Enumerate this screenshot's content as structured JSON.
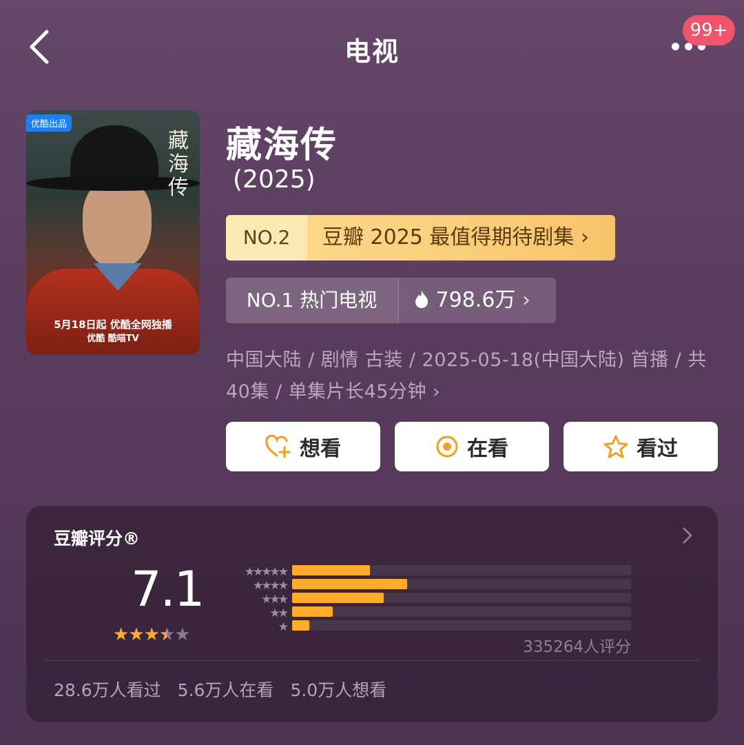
{
  "header": {
    "title": "电视",
    "badge": "99+"
  },
  "poster": {
    "tag": "优酷出品",
    "vertical_title": "藏海传",
    "line1": "5月18日起 优酷全网独播",
    "line2": "优酷 酷喵TV"
  },
  "show": {
    "title": "藏海传",
    "year": "(2025)"
  },
  "rankings": [
    {
      "no": "NO.2",
      "text": "豆瓣 2025 最值得期待剧集",
      "arrow": "›"
    },
    {
      "no": "NO.1 热门电视",
      "text": "798.6万",
      "arrow": "›"
    }
  ],
  "meta": {
    "line1": "中国大陆 / 剧情 古装 / 2025-05-18(中国大陆) 首播 / 共",
    "line2": "40集 / 单集片长45分钟 ›"
  },
  "actions": [
    {
      "label": "想看",
      "icon": "heart-plus-icon"
    },
    {
      "label": "在看",
      "icon": "target-icon"
    },
    {
      "label": "看过",
      "icon": "star-outline-icon"
    }
  ],
  "rating": {
    "title": "豆瓣评分®",
    "score": "7.1",
    "stars": 3.5,
    "distribution": [
      {
        "stars": "★★★★★",
        "fraction": 0.23
      },
      {
        "stars": "★★★★",
        "fraction": 0.34
      },
      {
        "stars": "★★★",
        "fraction": 0.27
      },
      {
        "stars": "★★",
        "fraction": 0.12
      },
      {
        "stars": "★",
        "fraction": 0.05
      }
    ],
    "votes": "335264人评分",
    "counts": [
      "28.6万人看过",
      "5.6万人在看",
      "5.0万人想看"
    ]
  },
  "colors": {
    "accent": "#ffac2d",
    "badge": "#f0546a",
    "rank_gold": "#fdd88a"
  }
}
